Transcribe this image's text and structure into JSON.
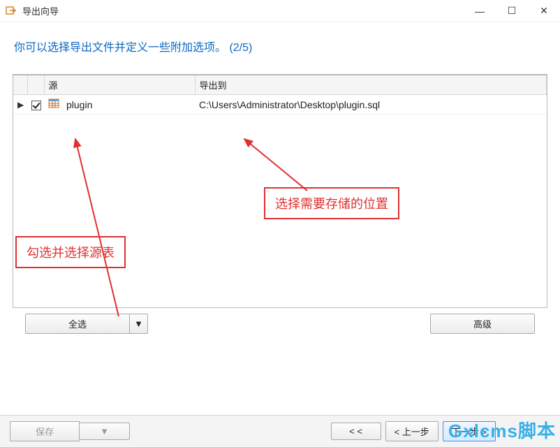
{
  "window": {
    "title": "导出向导",
    "minimize_label": "—",
    "maximize_label": "☐",
    "close_label": "✕"
  },
  "instruction": "你可以选择导出文件并定义一些附加选项。 (2/5)",
  "columns": {
    "source": "源",
    "dest": "导出到"
  },
  "rows": [
    {
      "checked": true,
      "source": "plugin",
      "dest": "C:\\Users\\Administrator\\Desktop\\plugin.sql"
    }
  ],
  "buttons": {
    "select_all": "全选",
    "select_all_drop": "▼",
    "advanced": "高级",
    "save": "保存",
    "save_drop": "▼",
    "first": "< <",
    "prev": "< 上一步",
    "next": "下一步 >",
    "last": "> >"
  },
  "annotations": {
    "source_hint": "勾选并选择源表",
    "dest_hint": "选择需要存储的位置"
  },
  "watermark": "Gxlcms脚本"
}
